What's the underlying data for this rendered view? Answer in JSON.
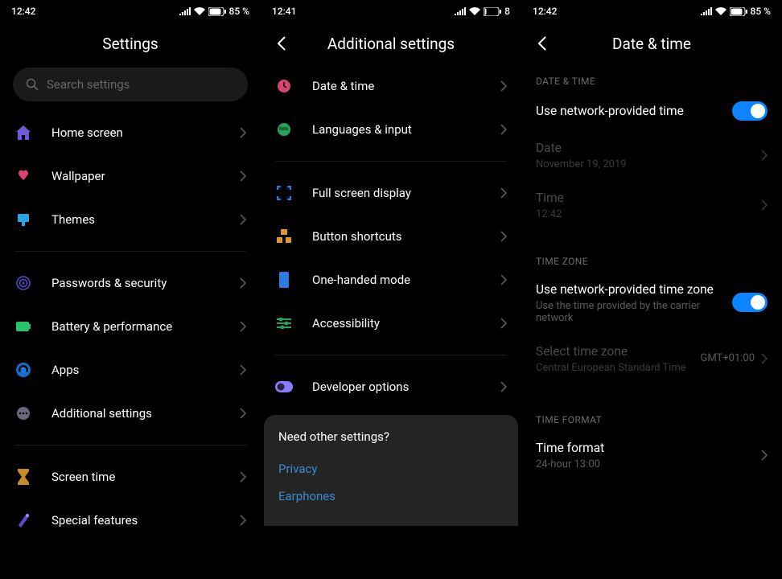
{
  "screen1": {
    "status_time": "12:42",
    "battery": "85",
    "title": "Settings",
    "search_placeholder": "Search settings",
    "items": [
      {
        "label": "Home screen"
      },
      {
        "label": "Wallpaper"
      },
      {
        "label": "Themes"
      },
      {
        "label": "Passwords & security"
      },
      {
        "label": "Battery & performance"
      },
      {
        "label": "Apps"
      },
      {
        "label": "Additional settings"
      },
      {
        "label": "Screen time"
      },
      {
        "label": "Special features"
      }
    ]
  },
  "screen2": {
    "status_time": "12:41",
    "battery": "8",
    "title": "Additional settings",
    "items": [
      {
        "label": "Date & time"
      },
      {
        "label": "Languages & input"
      },
      {
        "label": "Full screen display"
      },
      {
        "label": "Button shortcuts"
      },
      {
        "label": "One-handed mode"
      },
      {
        "label": "Accessibility"
      },
      {
        "label": "Developer options"
      }
    ],
    "card": {
      "title": "Need other settings?",
      "links": [
        "Privacy",
        "Earphones"
      ]
    }
  },
  "screen3": {
    "status_time": "12:42",
    "battery": "85",
    "title": "Date & time",
    "section1": "DATE & TIME",
    "net_time_label": "Use network-provided time",
    "date_label": "Date",
    "date_value": "November 19, 2019",
    "time_label": "Time",
    "time_value": "12:42",
    "section2": "TIME ZONE",
    "net_tz_label": "Use network-provided time zone",
    "net_tz_sub": "Use the time provided by the carrier network",
    "tz_label": "Select time zone",
    "tz_sub": "Central European Standard Time",
    "tz_value": "GMT+01:00",
    "section3": "TIME FORMAT",
    "fmt_label": "Time format",
    "fmt_sub": "24-hour 13:00"
  }
}
